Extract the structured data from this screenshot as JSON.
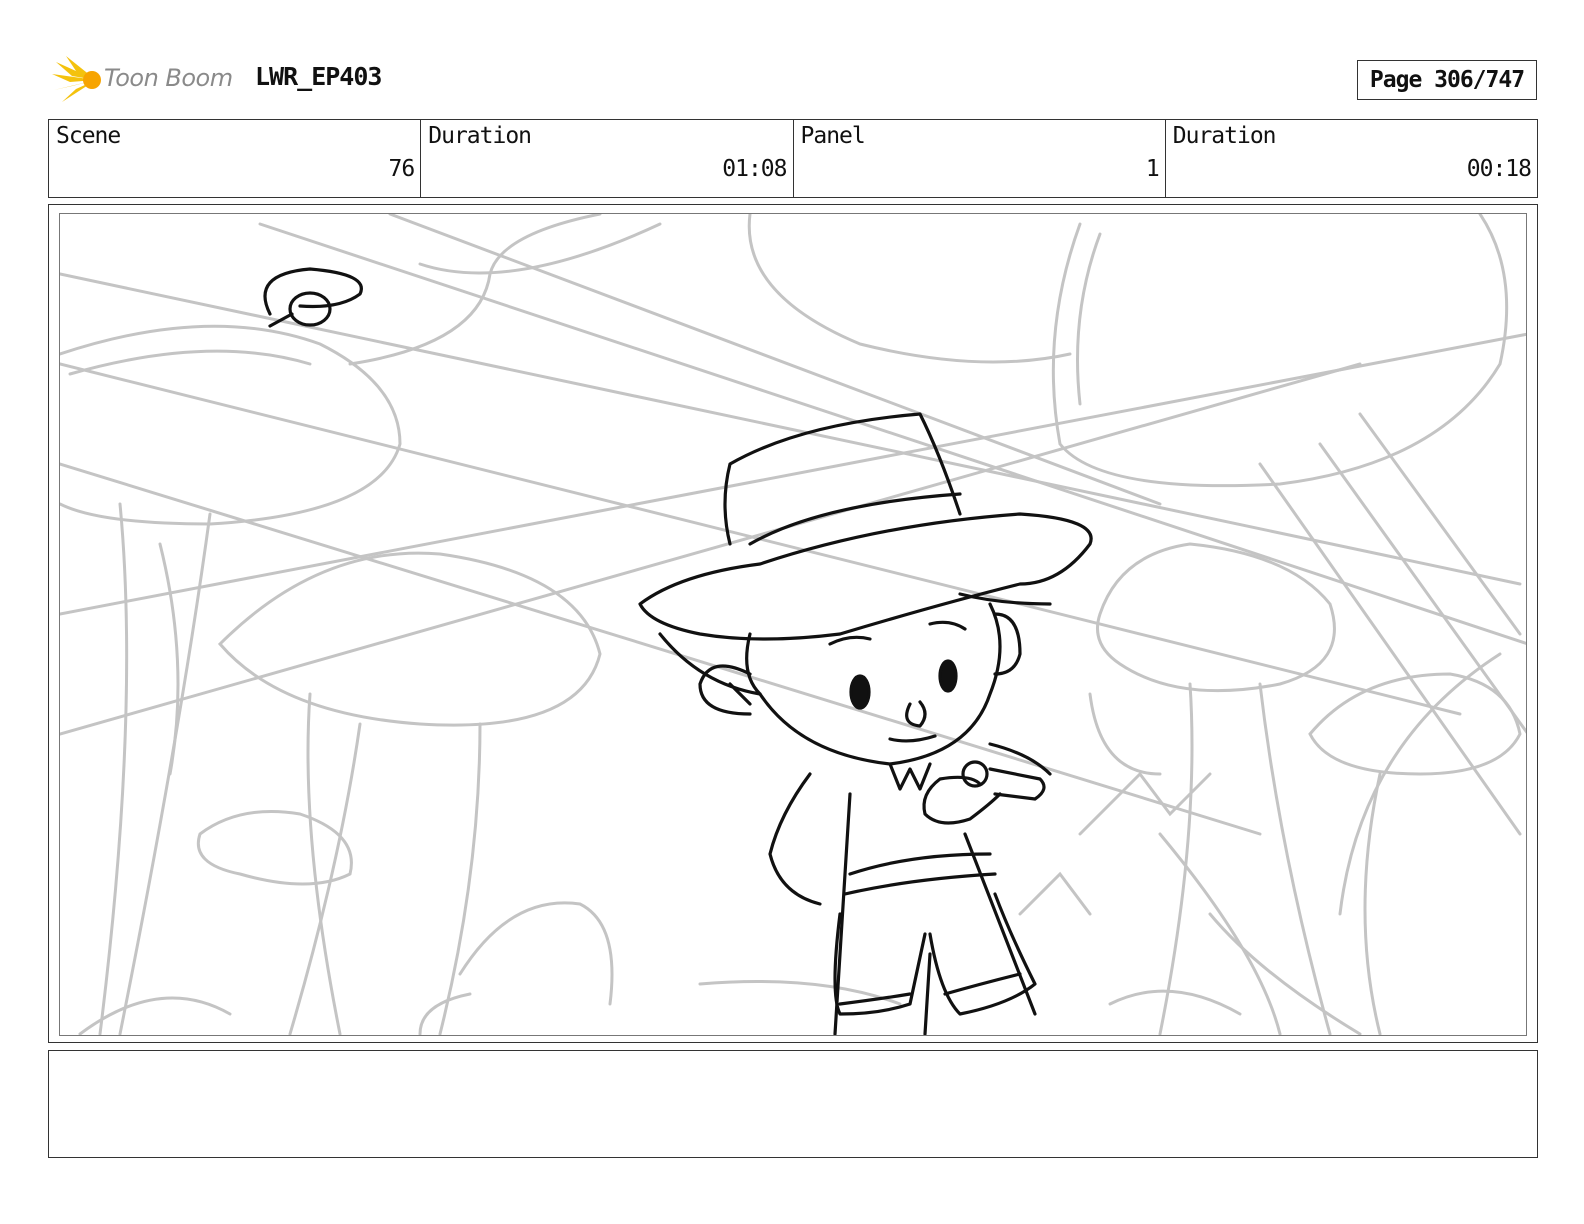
{
  "header": {
    "logo_text": "Toon Boom",
    "project": "LWR_EP403",
    "page": "Page 306/747"
  },
  "info": [
    {
      "label": "Scene",
      "value": "76"
    },
    {
      "label": "Duration",
      "value": "01:08"
    },
    {
      "label": "Panel",
      "value": "1"
    },
    {
      "label": "Duration",
      "value": "00:18"
    }
  ],
  "panel": {
    "image_description": ""
  },
  "notes": {
    "text": ""
  }
}
